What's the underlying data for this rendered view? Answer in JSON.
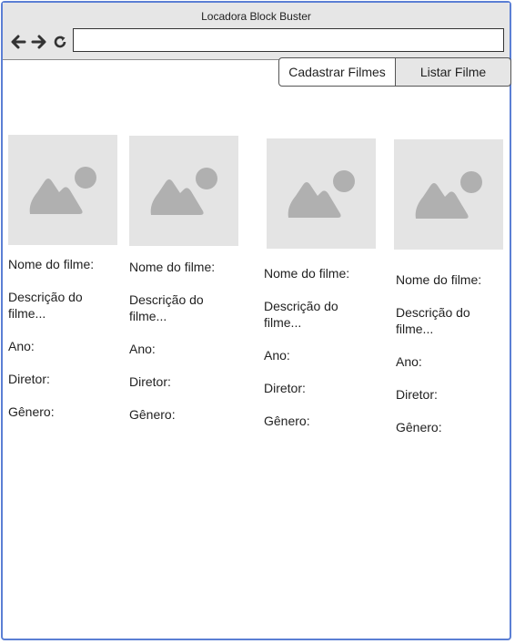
{
  "window": {
    "title": "Locadora Block Buster"
  },
  "address_bar": {
    "value": ""
  },
  "tabs": [
    {
      "label": "Cadastrar Filmes"
    },
    {
      "label": "Listar Filme"
    }
  ],
  "movies": [
    {
      "name": "Nome do filme:",
      "description": "Descrição do filme...",
      "year": "Ano:",
      "director": "Diretor:",
      "genre": "Gênero:"
    },
    {
      "name": "Nome do filme:",
      "description": "Descrição do filme...",
      "year": "Ano:",
      "director": "Diretor:",
      "genre": "Gênero:"
    },
    {
      "name": "Nome do filme:",
      "description": "Descrição do filme...",
      "year": "Ano:",
      "director": "Diretor:",
      "genre": "Gênero:"
    },
    {
      "name": "Nome do filme:",
      "description": "Descrição do filme...",
      "year": "Ano:",
      "director": "Diretor:",
      "genre": "Gênero:"
    }
  ],
  "icons": {
    "back": "arrow-left-icon",
    "forward": "arrow-right-icon",
    "reload": "reload-icon",
    "thumbnail": "image-placeholder-icon"
  }
}
